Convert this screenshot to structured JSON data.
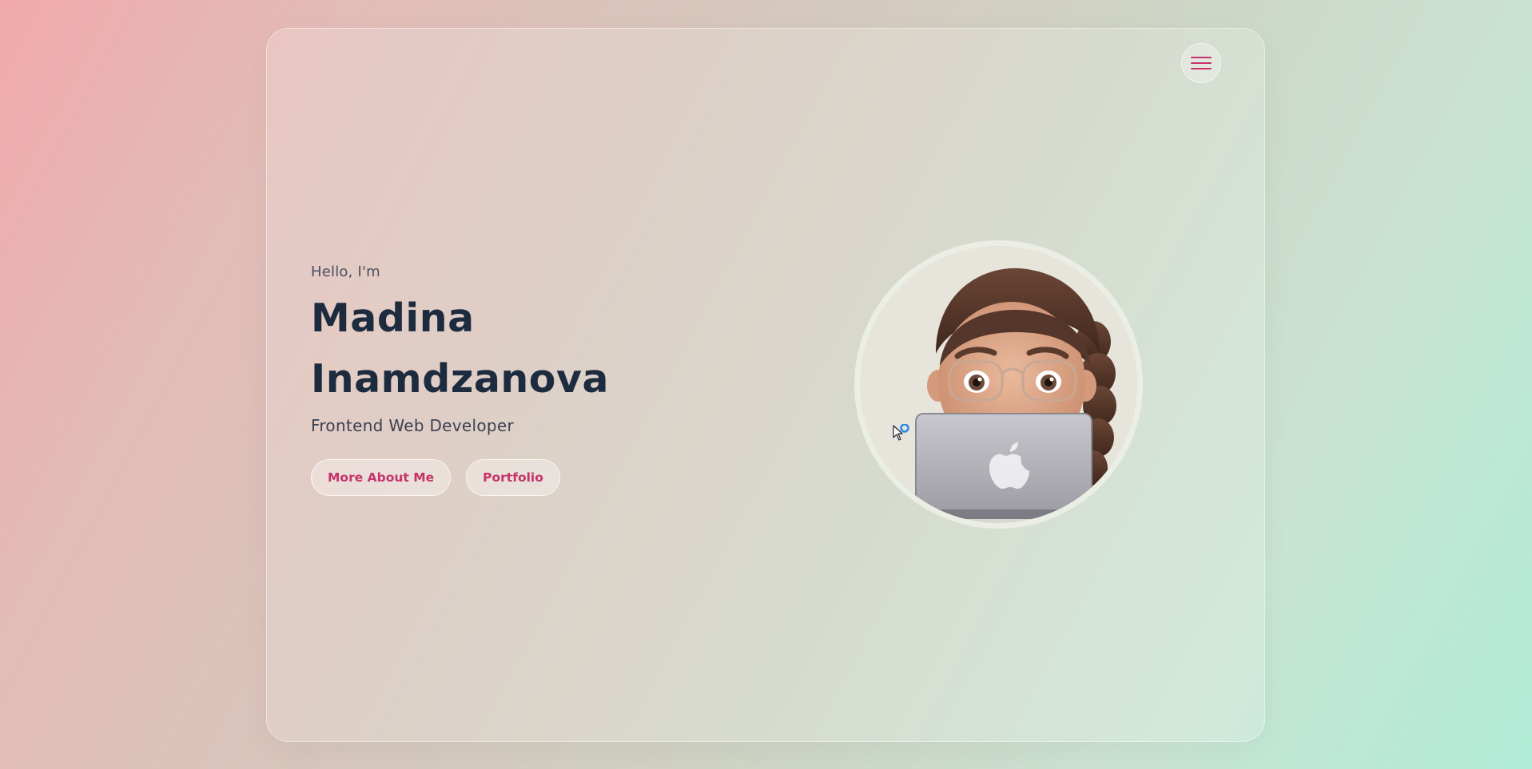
{
  "colors": {
    "accent": "#c6336b",
    "heading": "#1d2b3f",
    "text": "#3a4152"
  },
  "nav": {
    "menu_icon": "hamburger-menu-icon"
  },
  "hero": {
    "greeting": "Hello, I'm",
    "name_first": "Madina",
    "name_last": "Inamdzanova",
    "role": "Frontend Web Developer",
    "buttons": [
      {
        "label": "More About Me"
      },
      {
        "label": "Portfolio"
      }
    ]
  },
  "avatar": {
    "icon": "memoji-avatar-with-laptop"
  }
}
